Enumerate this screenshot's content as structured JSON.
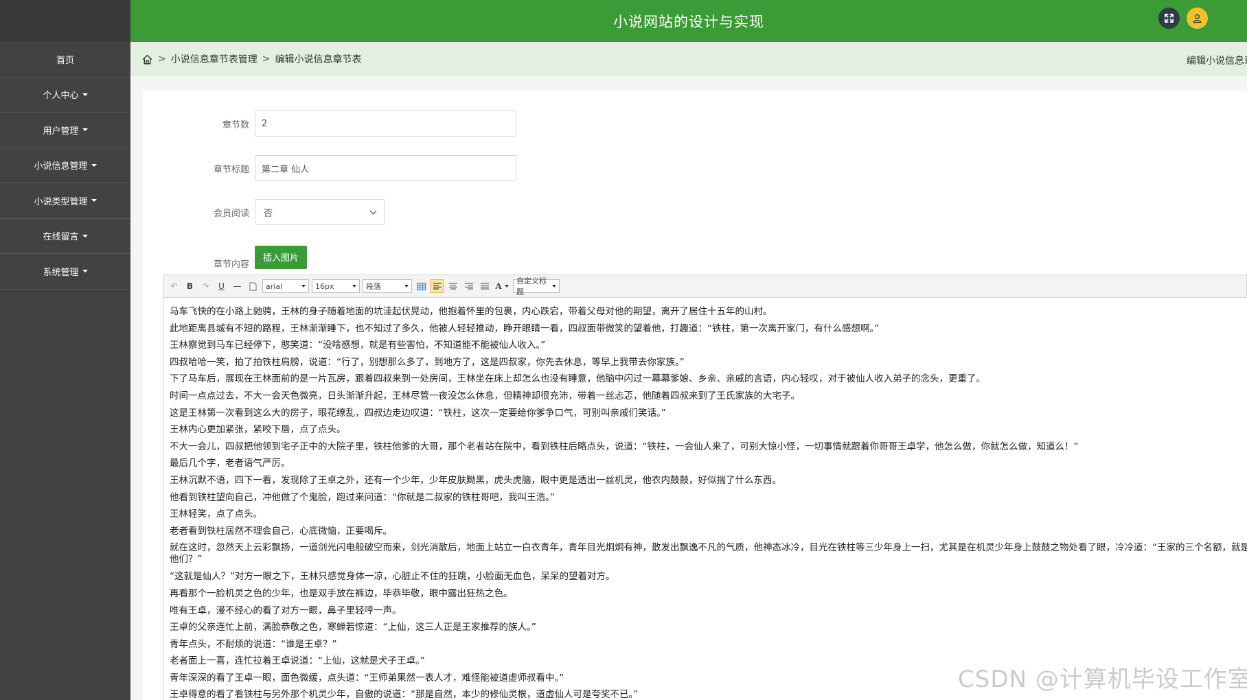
{
  "app": {
    "title": "小说网站的设计与实现"
  },
  "sidebar": {
    "items": [
      {
        "label": "首页",
        "has_dropdown": false
      },
      {
        "label": "个人中心",
        "has_dropdown": true
      },
      {
        "label": "用户管理",
        "has_dropdown": true
      },
      {
        "label": "小说信息管理",
        "has_dropdown": true
      },
      {
        "label": "小说类型管理",
        "has_dropdown": true
      },
      {
        "label": "在线留言",
        "has_dropdown": true
      },
      {
        "label": "系统管理",
        "has_dropdown": true
      }
    ]
  },
  "breadcrumb": {
    "items": [
      "小说信息章节表管理",
      "编辑小说信息章节表"
    ],
    "right_title": "编辑小说信息章"
  },
  "form": {
    "chapter_number": {
      "label": "章节数",
      "value": "2"
    },
    "chapter_title": {
      "label": "章节标题",
      "value": "第二章 仙人"
    },
    "member_reading": {
      "label": "会员阅读",
      "value": "否"
    },
    "chapter_content": {
      "label": "章节内容",
      "insert_image_label": "插入图片"
    }
  },
  "editor": {
    "toolbar": {
      "bold": "B",
      "underline": "U",
      "font_family": "arial",
      "font_size": "16px",
      "paragraph": "段落",
      "font_color": "A",
      "custom_title": "自定义标题"
    },
    "paragraphs": [
      "马车飞快的在小路上驰骋，王林的身子随着地面的坑洼起伏晃动，他抱着怀里的包裹，内心跌宕，带着父母对他的期望，离开了居住十五年的山村。",
      "此地距离县城有不短的路程，王林渐渐睡下，也不知过了多久，他被人轻轻推动，睁开眼睛一看，四叔面带微笑的望着他，打趣道：“铁柱，第一次离开家门，有什么感想啊。”",
      "王林察觉到马车已经停下，憨笑道：“没啥感想，就是有些害怕，不知道能不能被仙人收入。”",
      "四叔哈哈一笑，拍了拍铁柱肩膀，说道：“行了，别想那么多了，到地方了，这是四叔家，你先去休息，等早上我带去你家族。”",
      "下了马车后，展现在王林面前的是一片瓦房，跟着四叔来到一处房间，王林坐在床上却怎么也没有睡意，他脑中闪过一幕幕爹娘、乡亲、亲戚的言语，内心轻叹，对于被仙人收入弟子的念头，更重了。",
      "时间一点点过去，不大一会天色微亮，日头渐渐升起，王林尽管一夜没怎么休息，但精神却很充沛，带着一丝忐忑，他随着四叔来到了王氏家族的大宅子。",
      "这是王林第一次看到这么大的房子，眼花缭乱，四叔边走边叹道：“铁柱，这次一定要给你爹争口气，可别叫亲戚们笑话。”",
      "王林内心更加紧张，紧咬下唇，点了点头。",
      "不大一会儿，四叔把他领到宅子正中的大院子里，铁柱他爹的大哥，那个老者站在院中，看到铁柱后略点头，说道：“铁柱，一会仙人来了，可别大惊小怪，一切事情就跟着你哥哥王卓学，他怎么做，你就怎么做，知道么！”",
      "最后几个字，老者语气严厉。",
      "王林沉默不语，四下一看，发现除了王卓之外，还有一个少年，少年皮肤黝黑，虎头虎脑，眼中更是透出一丝机灵，他衣内鼓鼓，好似揣了什么东西。",
      "他看到铁柱望向自己，冲他做了个鬼脸，跑过来问道：“你就是二叔家的铁柱哥吧，我叫王浩。”",
      "王林轻笑，点了点头。",
      "老者看到铁柱居然不理会自己，心底微恼，正要喝斥。",
      "就在这时，忽然天上云彩飘扬，一道剑光闪电般破空而来，剑光消散后，地面上站立一白衣青年，青年目光炯炯有神，散发出飘逸不凡的气质，他神态冰冷，目光在铁柱等三少年身上一扫，尤其是在机灵少年身上鼓鼓之物处看了眼，冷冷道：“王家的三个名额，就是他们？”",
      "“这就是仙人？”对方一眼之下，王林只感觉身体一凉，心脏止不住的狂跳，小脸面无血色，呆呆的望着对方。",
      "再看那个一脸机灵之色的少年，也是双手放在裤边，毕恭毕敬，眼中露出狂热之色。",
      "唯有王卓，漫不经心的看了对方一眼，鼻子里轻哼一声。",
      "王卓的父亲连忙上前，满脸恭敬之色，寒蝉若惊道：“上仙，这三人正是王家推荐的族人。”",
      "青年点头，不耐烦的说道：“谁是王卓？”",
      "老者面上一喜，连忙拉着王卓说道：“上仙，这就是犬子王卓。”",
      "青年深深的看了王卓一眼，面色微缓，点头道：“王师弟果然一表人才，难怪能被道虚师叔看中。”",
      "王卓得意的看了看铁柱与另外那个机灵少年，自傲的说道：“那是自然，本少的修仙灵根，道虚仙人可是夸奖不已。”"
    ]
  },
  "watermark": "CSDN @计算机毕设工作室",
  "colors": {
    "header_green": "#3b9b36",
    "sidebar_bg": "#424242",
    "breadcrumb_bg": "#e3f0e1",
    "user_avatar": "#f2c12e"
  }
}
